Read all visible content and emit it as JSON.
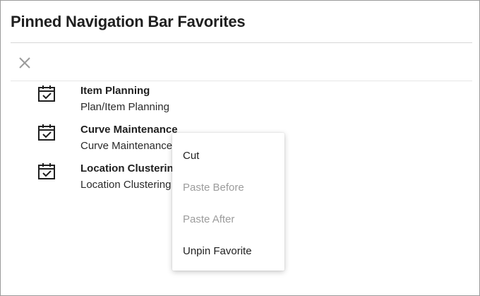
{
  "dialog": {
    "title": "Pinned Navigation Bar Favorites",
    "close_icon": "close-icon"
  },
  "favorites": [
    {
      "name": "Item Planning",
      "path": "Plan/Item Planning",
      "icon": "calendar-check-icon"
    },
    {
      "name": "Curve Maintenance",
      "path": "Curve Maintenance",
      "icon": "calendar-check-icon"
    },
    {
      "name": "Location Clustering",
      "path": "Location Clustering",
      "icon": "calendar-check-icon"
    }
  ],
  "context_menu": {
    "items": [
      {
        "label": "Cut",
        "enabled": true
      },
      {
        "label": "Paste Before",
        "enabled": false
      },
      {
        "label": "Paste After",
        "enabled": false
      },
      {
        "label": "Unpin Favorite",
        "enabled": true
      }
    ]
  },
  "colors": {
    "text": "#1f1f1f",
    "disabled_text": "#9c9c9c",
    "separator": "#d6d6d6",
    "border": "#9a9a9a"
  }
}
